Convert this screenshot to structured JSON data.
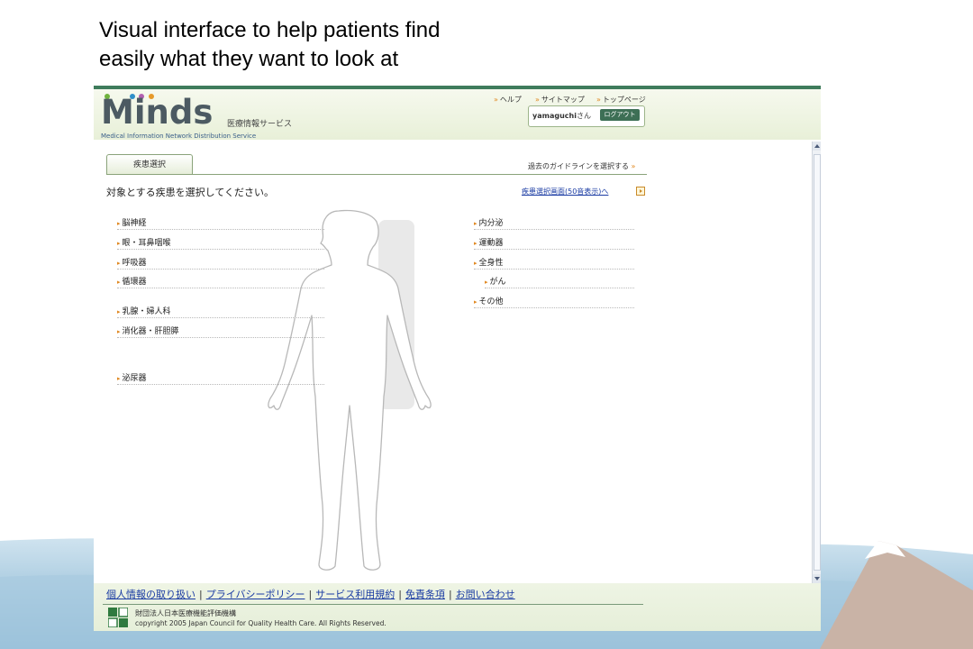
{
  "slide": {
    "caption_line1": "Visual interface to help patients find",
    "caption_line2": "easily what they want to look at"
  },
  "header": {
    "logo_text": "Minds",
    "logo_subtitle": "医療情報サービス",
    "logo_tagline": "Medical Information Network Distribution Service",
    "nav": [
      "ヘルプ",
      "サイトマップ",
      "トップページ"
    ],
    "user_name": "yamaguchi",
    "user_suffix": "さん",
    "logout_label": "ログアウト"
  },
  "content": {
    "tab_label": "疾患選択",
    "past_guideline_link": "過去のガイドラインを選択する",
    "instruction": "対象とする疾患を選択してください。",
    "list_view_link": "疾患選択画面(50音表示)へ",
    "left_categories": [
      "脳神経",
      "眼・耳鼻咽喉",
      "呼吸器",
      "循環器",
      "乳腺・婦人科",
      "消化器・肝胆膵",
      "泌尿器"
    ],
    "right_categories": [
      "内分泌",
      "運動器",
      "全身性",
      "がん",
      "その他"
    ]
  },
  "footer": {
    "links": [
      "個人情報の取り扱い",
      "プライバシーポリシー",
      "サービス利用規約",
      "免責条項",
      "お問い合わせ"
    ],
    "org_name": "財団法人日本医療機能評価機構",
    "copyright": "copyright 2005 Japan Council for Quality Health Care. All Rights Reserved."
  },
  "colors": {
    "accent_green": "#3f7c5c",
    "link_blue": "#1a3ba3",
    "arrow_orange": "#e0871f"
  }
}
